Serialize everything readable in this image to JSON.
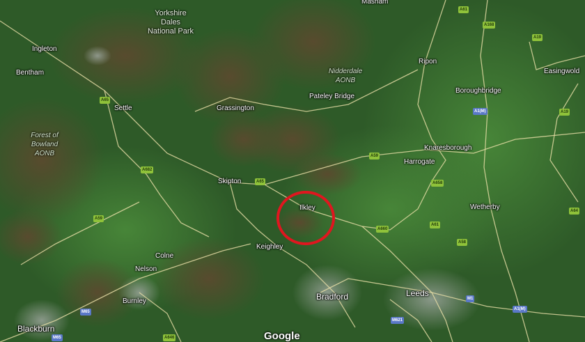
{
  "places": {
    "masham": "Masham",
    "ingleton": "Ingleton",
    "bentham": "Bentham",
    "ripon": "Ripon",
    "easingwold": "Easingwold",
    "boroughbridge": "Boroughbridge",
    "settle": "Settle",
    "grassington": "Grassington",
    "pateley_bridge": "Pateley Bridge",
    "knaresborough": "Knaresborough",
    "harrogate": "Harrogate",
    "skipton": "Skipton",
    "ilkley": "Ilkley",
    "wetherby": "Wetherby",
    "keighley": "Keighley",
    "colne": "Colne",
    "nelson": "Nelson",
    "burnley": "Burnley",
    "bradford": "Bradford",
    "leeds": "Leeds",
    "blackburn": "Blackburn"
  },
  "areas": {
    "yorkshire_dales_1": "Yorkshire",
    "yorkshire_dales_2": "Dales",
    "yorkshire_dales_3": "National Park",
    "nidderdale_1": "Nidderdale",
    "nidderdale_2": "AONB",
    "bowland_1": "Forest of",
    "bowland_2": "Bowland",
    "bowland_3": "AONB"
  },
  "roads": {
    "a61_top": "A61",
    "a168": "A168",
    "a19_top": "A19",
    "a1m_mid": "A1(M)",
    "a19_right": "A19",
    "a65_settle": "A65",
    "a59_mid": "A59",
    "a682": "A682",
    "a65_skipton": "A65",
    "a658": "A658",
    "a59_west": "A59",
    "a660": "A660",
    "a61_harrogate": "A61",
    "a58": "A58",
    "a64_right": "A64",
    "m1": "M1",
    "a1m_bottom": "A1(M)",
    "m621": "M621",
    "m65_bottom": "M65",
    "m65_left": "M65",
    "a646": "A646"
  },
  "logo": "Google",
  "colors": {
    "highlight": "#e0161f",
    "road_badge_a": "#8fc23a",
    "road_badge_m": "#5a78c8"
  }
}
